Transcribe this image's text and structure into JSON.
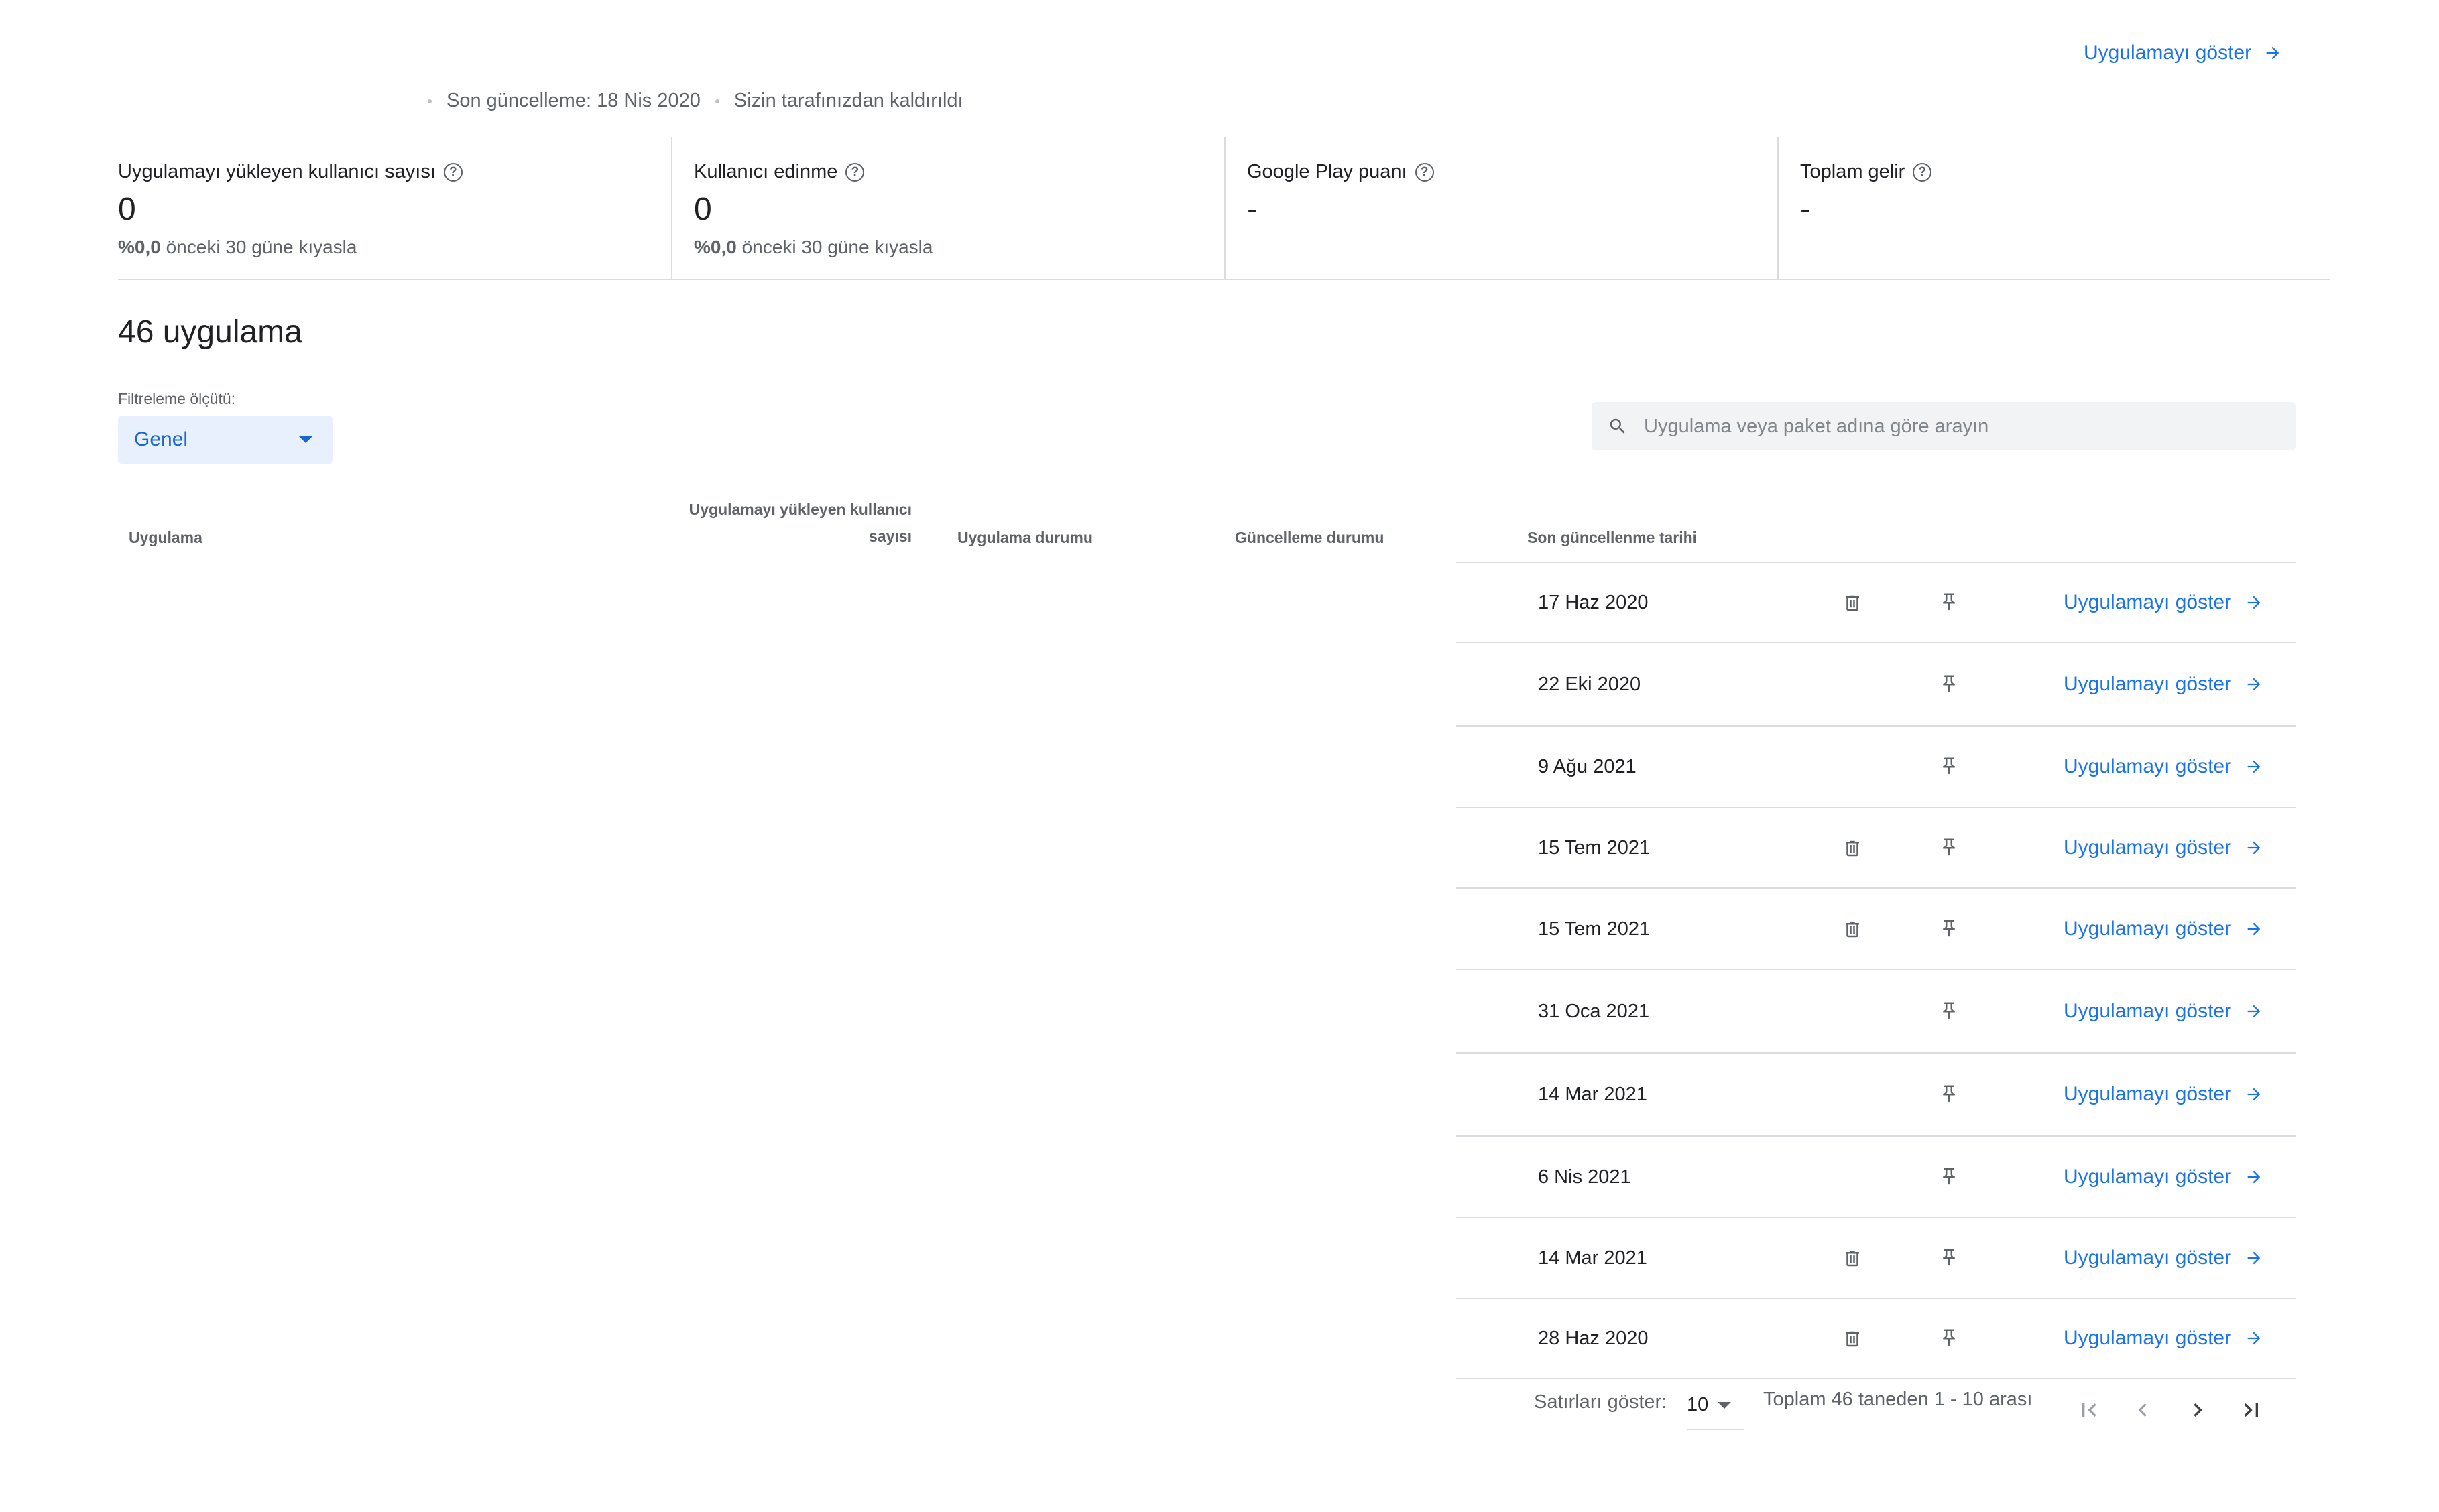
{
  "header": {
    "view_app_label": "Uygulamayı göster",
    "last_updated": "Son güncelleme: 18 Nis 2020",
    "removed_status": "Sizin tarafınızdan kaldırıldı"
  },
  "stats": [
    {
      "title": "Uygulamayı yükleyen kullanıcı sayısı",
      "value": "0",
      "delta": "%0,0",
      "compare": "önceki 30 güne kıyasla"
    },
    {
      "title": "Kullanıcı edinme",
      "value": "0",
      "delta": "%0,0",
      "compare": "önceki 30 güne kıyasla"
    },
    {
      "title": "Google Play puanı",
      "value": "-",
      "delta": "",
      "compare": ""
    },
    {
      "title": "Toplam gelir",
      "value": "-",
      "delta": "",
      "compare": ""
    }
  ],
  "apps": {
    "count_title": "46 uygulama",
    "filter_label": "Filtreleme ölçütü:",
    "filter_value": "Genel",
    "search_placeholder": "Uygulama veya paket adına göre arayın"
  },
  "table": {
    "columns": {
      "app": "Uygulama",
      "installs_line1": "Uygulamayı yükleyen kullanıcı",
      "installs_line2": "sayısı",
      "app_status": "Uygulama durumu",
      "update_status": "Güncelleme durumu",
      "last_update": "Son güncellenme tarihi"
    },
    "rows": [
      {
        "date": "17 Haz 2020",
        "has_delete": true,
        "view_label": "Uygulamayı göster"
      },
      {
        "date": "22 Eki 2020",
        "has_delete": false,
        "view_label": "Uygulamayı göster"
      },
      {
        "date": "9 Ağu 2021",
        "has_delete": false,
        "view_label": "Uygulamayı göster"
      },
      {
        "date": "15 Tem 2021",
        "has_delete": true,
        "view_label": "Uygulamayı göster"
      },
      {
        "date": "15 Tem 2021",
        "has_delete": true,
        "view_label": "Uygulamayı göster"
      },
      {
        "date": "31 Oca 2021",
        "has_delete": false,
        "view_label": "Uygulamayı göster"
      },
      {
        "date": "14 Mar 2021",
        "has_delete": false,
        "view_label": "Uygulamayı göster"
      },
      {
        "date": "6 Nis 2021",
        "has_delete": false,
        "view_label": "Uygulamayı göster"
      },
      {
        "date": "14 Mar 2021",
        "has_delete": true,
        "view_label": "Uygulamayı göster"
      },
      {
        "date": "28 Haz 2020",
        "has_delete": true,
        "view_label": "Uygulamayı göster"
      }
    ]
  },
  "pagination": {
    "rows_label": "Satırları göster:",
    "rows_value": "10",
    "range_text": "Toplam 46 taneden 1 - 10 arası"
  },
  "icons": {
    "help": "help-circle-icon",
    "search": "search-icon",
    "delete": "trash-icon",
    "pin": "pin-icon",
    "arrow": "arrow-right-icon",
    "first": "first-page-icon",
    "prev": "chevron-left-icon",
    "next": "chevron-right-icon",
    "last": "last-page-icon"
  },
  "colors": {
    "link": "#1a73e8",
    "filter_bg": "#e8f0fe",
    "divider": "#dadce0"
  }
}
